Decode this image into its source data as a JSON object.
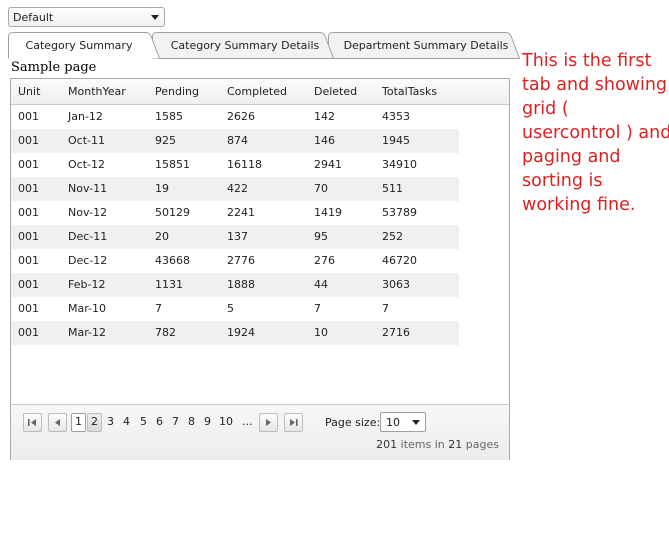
{
  "dropdown": {
    "value": "Default"
  },
  "tabs": [
    {
      "label": "Category Summary",
      "active": true
    },
    {
      "label": "Category Summary Details",
      "active": false
    },
    {
      "label": "Department Summary Details",
      "active": false
    }
  ],
  "page_heading": "Sample page",
  "grid": {
    "columns": [
      "Unit",
      "MonthYear",
      "Pending",
      "Completed",
      "Deleted",
      "TotalTasks"
    ],
    "rows": [
      [
        "001",
        "Jan-12",
        "1585",
        "2626",
        "142",
        "4353"
      ],
      [
        "001",
        "Oct-11",
        "925",
        "874",
        "146",
        "1945"
      ],
      [
        "001",
        "Oct-12",
        "15851",
        "16118",
        "2941",
        "34910"
      ],
      [
        "001",
        "Nov-11",
        "19",
        "422",
        "70",
        "511"
      ],
      [
        "001",
        "Nov-12",
        "50129",
        "2241",
        "1419",
        "53789"
      ],
      [
        "001",
        "Dec-11",
        "20",
        "137",
        "95",
        "252"
      ],
      [
        "001",
        "Dec-12",
        "43668",
        "2776",
        "276",
        "46720"
      ],
      [
        "001",
        "Feb-12",
        "1131",
        "1888",
        "44",
        "3063"
      ],
      [
        "001",
        "Mar-10",
        "7",
        "5",
        "7",
        "7"
      ],
      [
        "001",
        "Mar-12",
        "782",
        "1924",
        "10",
        "2716"
      ]
    ]
  },
  "pager": {
    "pages": [
      "1",
      "2",
      "3",
      "4",
      "5",
      "6",
      "7",
      "8",
      "9",
      "10"
    ],
    "current_page": "1",
    "ellipsis": "...",
    "page_size_label": "Page size:",
    "page_size": "10",
    "items_count": "201",
    "items_text": "items in",
    "pages_count": "21",
    "pages_text": "pages"
  },
  "annotation": "This is the first tab and showing grid ( usercontrol ) and paging and sorting is working fine."
}
